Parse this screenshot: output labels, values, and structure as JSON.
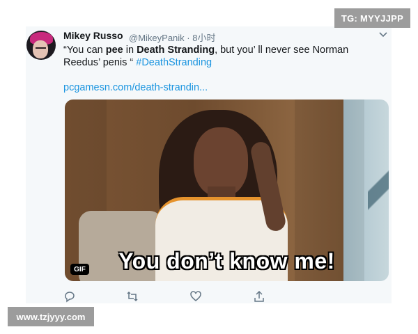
{
  "watermarks": {
    "top_right": "TG: MYYJJPP",
    "bottom_left": "www.tzjyyy.com"
  },
  "tweet": {
    "author_name": "Mikey Russo",
    "handle_time": "@MikeyPanik · 8小时",
    "text_parts": {
      "p1": "“You can ",
      "p2": "pee",
      "p3": " in ",
      "p4": "Death Stranding",
      "p5": ", but you’ ll never see Norman Reedus’  penis “ ",
      "hashtag": "#DeathStranding"
    },
    "link": "pcgamesn.com/death-strandin...",
    "media": {
      "caption": "You don’t know me!",
      "badge": "GIF"
    }
  },
  "icons": {
    "avatar": "profile-photo",
    "menu": "chevron-down-icon",
    "reply": "reply-icon",
    "retweet": "retweet-icon",
    "like": "heart-icon",
    "share": "share-icon"
  },
  "colors": {
    "link": "#1b95e0",
    "card_bg": "#f5f8fa",
    "text": "#14171a",
    "muted": "#657786"
  }
}
